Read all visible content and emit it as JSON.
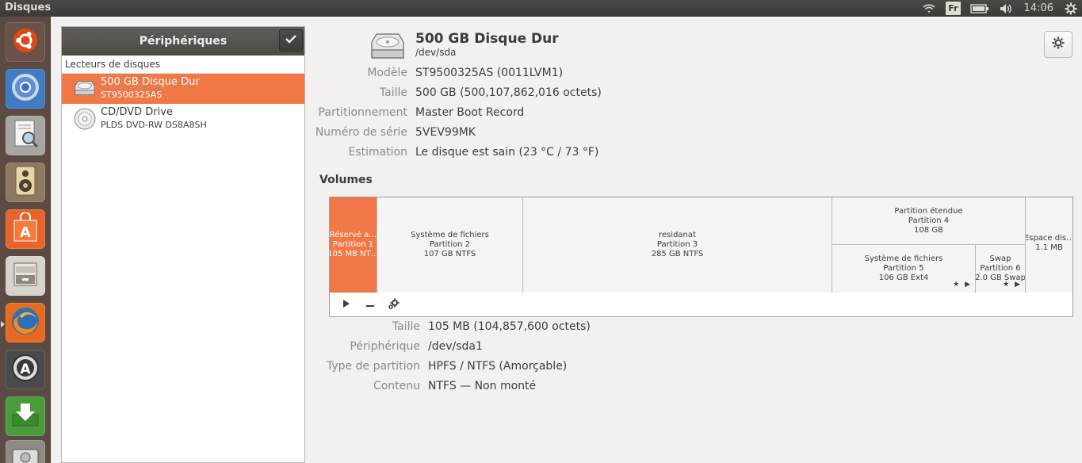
{
  "topbar": {
    "app_title": "Disques",
    "lang": "Fr",
    "clock": "14:06"
  },
  "launcher": {
    "items": [
      {
        "name": "ubuntu-dash",
        "icon": "ubuntu-logo-icon",
        "color": "#6b5248"
      },
      {
        "name": "chromium",
        "icon": "chromium-icon",
        "color": "#3f7cc5"
      },
      {
        "name": "document-viewer",
        "icon": "document-viewer-icon",
        "color": "#a8a6a2"
      },
      {
        "name": "rhythmbox",
        "icon": "speaker-icon",
        "color": "#8b7a5f"
      },
      {
        "name": "software-center",
        "icon": "shopping-bag-icon",
        "color": "#e8642b"
      },
      {
        "name": "file-manager",
        "icon": "file-cabinet-icon",
        "color": "#d7d3cb"
      },
      {
        "name": "firefox",
        "icon": "firefox-icon",
        "color": "#e66a1f"
      },
      {
        "name": "software-updater",
        "icon": "updater-icon",
        "color": "#4a4a4a"
      },
      {
        "name": "download-manager",
        "icon": "download-arrow-icon",
        "color": "#4a9b3c"
      },
      {
        "name": "disks",
        "icon": "disks-icon",
        "color": "#8d8a84"
      }
    ]
  },
  "sidebar": {
    "title": "Périphériques",
    "section_label": "Lecteurs de disques",
    "drives": [
      {
        "name": "500 GB Disque Dur",
        "model": "ST9500325AS",
        "selected": true,
        "icon": "hard-disk-icon"
      },
      {
        "name": "CD/DVD Drive",
        "model": "PLDS DVD-RW DS8A8SH",
        "selected": false,
        "icon": "optical-disc-icon"
      }
    ]
  },
  "disk": {
    "title": "500 GB Disque Dur",
    "device": "/dev/sda",
    "properties": [
      {
        "key": "Modèle",
        "value": "ST9500325AS (0011LVM1)"
      },
      {
        "key": "Taille",
        "value": "500 GB (500,107,862,016 octets)"
      },
      {
        "key": "Partitionnement",
        "value": "Master Boot Record"
      },
      {
        "key": "Numéro de série",
        "value": "5VEV99MK"
      },
      {
        "key": "Estimation",
        "value": "Le disque est sain (23 °C / 73 °F)"
      }
    ]
  },
  "volumes": {
    "label": "Volumes",
    "segments": [
      {
        "lines": [
          "Réservé a…",
          "Partition 1",
          "105 MB NT…"
        ],
        "selected": true
      },
      {
        "lines": [
          "Système de fichiers",
          "Partition 2",
          "107 GB NTFS"
        ],
        "selected": false
      },
      {
        "lines": [
          "residanat",
          "Partition 3",
          "285 GB NTFS"
        ],
        "selected": false
      },
      {
        "lines": [
          "Partition étendue",
          "Partition 4",
          "108 GB"
        ],
        "selected": false
      },
      {
        "lines": [
          "Système de fichiers",
          "Partition 5",
          "106 GB Ext4"
        ],
        "selected": false
      },
      {
        "lines": [
          "Swap",
          "Partition 6",
          "2.0 GB Swap"
        ],
        "selected": false
      },
      {
        "lines": [
          "Espace dis…",
          "1.1 MB"
        ],
        "selected": false
      }
    ],
    "marks": "★ ▶"
  },
  "selected_partition": {
    "properties": [
      {
        "key": "Taille",
        "value": "105 MB (104,857,600 octets)"
      },
      {
        "key": "Périphérique",
        "value": "/dev/sda1"
      },
      {
        "key": "Type de partition",
        "value": "HPFS / NTFS (Amorçable)"
      },
      {
        "key": "Contenu",
        "value": "NTFS — Non monté"
      }
    ]
  }
}
